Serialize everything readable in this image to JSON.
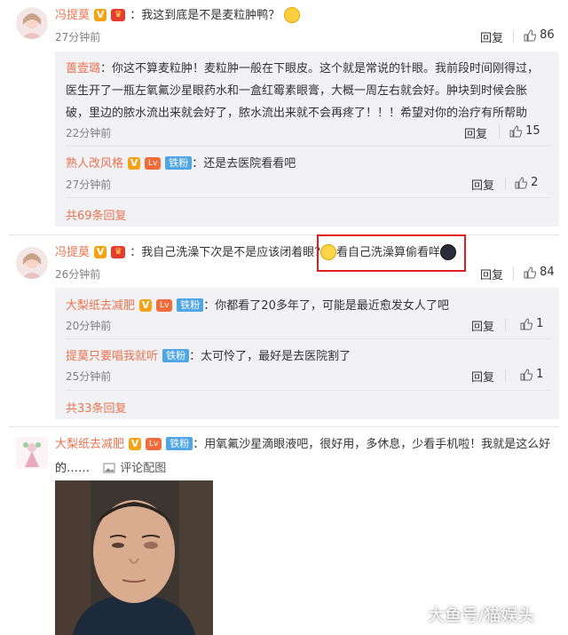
{
  "comments": [
    {
      "user": "冯提莫",
      "text": "：我这到底是不是麦粒肿鸭？",
      "time": "27分钟前",
      "reply": "回复",
      "likes": "86",
      "replies": [
        {
          "user": "蔷壹璐",
          "text_lines": [
            "：你这不算麦粒肿！麦粒肿一般在下眼皮。这个就是常说的针眼。我前段时间刚得过，",
            "医生开了一瓶左氧氟沙星眼药水和一盒红霉素眼膏，大概一周左右就会好。肿块到时候会胀",
            "破，里边的脓水流出来就会好了，脓水流出来就不会再疼了！！！希望对你的治疗有所帮助"
          ],
          "time": "22分钟前",
          "reply": "回复",
          "likes": "15"
        },
        {
          "user": "熟人改风格",
          "fan_badge": "铁粉",
          "text": "：还是去医院看看吧",
          "time": "27分钟前",
          "reply": "回复",
          "likes": "2"
        }
      ],
      "more": "共69条回复"
    },
    {
      "user": "冯提莫",
      "text": "：我自己洗澡下次是不是应该闭着眼？",
      "highlight_text": "看自己洗澡算偷看咩",
      "time": "26分钟前",
      "reply": "回复",
      "likes": "84",
      "replies": [
        {
          "user": "大梨纸去减肥",
          "fan_badge": "铁粉",
          "text": "：你都看了20多年了，可能是最近愈发女人了吧",
          "time": "20分钟前",
          "reply": "回复",
          "likes": "1"
        },
        {
          "user": "提莫只要唱我就听",
          "fan_badge": "铁粉",
          "text": "：太可怜了，最好是去医院割了",
          "time": "25分钟前",
          "reply": "回复",
          "likes": "1"
        }
      ],
      "more": "共33条回复"
    },
    {
      "user": "大梨纸去减肥",
      "fan_badge": "铁粉",
      "text_lines": [
        "：用氧氟沙星滴眼液吧，很好用，多休息，少看手机啦！我就是这么好",
        "的……"
      ],
      "image_link": "评论配图"
    }
  ],
  "watermark": "大鱼号/猫娱头",
  "colors": {
    "name": "#eb7350",
    "highlight_box": "#e02020",
    "subbg": "#f2f2f5"
  },
  "icons": [
    "like-icon",
    "vip-v-icon",
    "crown-badge-icon",
    "image-icon"
  ]
}
